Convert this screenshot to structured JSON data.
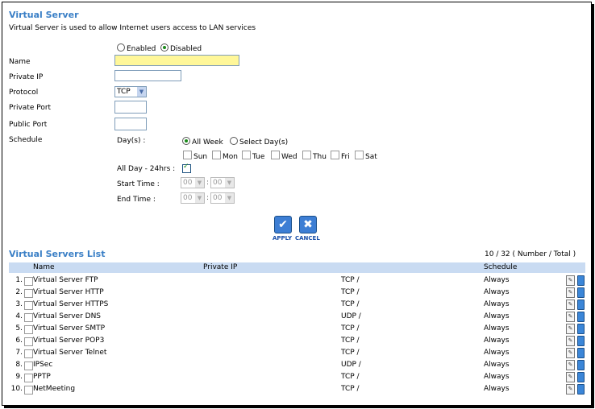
{
  "section": {
    "title": "Virtual Server",
    "description": "Virtual Server is used to allow Internet users access to LAN services",
    "enabled_label": "Enabled",
    "disabled_label": "Disabled",
    "selected_mode": "Disabled"
  },
  "form": {
    "name_label": "Name",
    "name_value": "",
    "private_ip_label": "Private IP",
    "private_ip_value": "",
    "protocol_label": "Protocol",
    "protocol_value": "TCP",
    "private_port_label": "Private Port",
    "private_port_value": "",
    "public_port_label": "Public Port",
    "public_port_value": "",
    "schedule_label": "Schedule",
    "days_label": "Day(s) :",
    "all_week_label": "All Week",
    "select_days_label": "Select Day(s)",
    "days": [
      "Sun",
      "Mon",
      "Tue",
      "Wed",
      "Thu",
      "Fri",
      "Sat"
    ],
    "all_day_label": "All Day - 24hrs :",
    "all_day_checked": true,
    "start_time_label": "Start Time :",
    "end_time_label": "End Time :",
    "time_hour": "00",
    "time_minute": "00",
    "time_separator": ":"
  },
  "buttons": {
    "apply_label": "APPLY",
    "cancel_label": "CANCEL"
  },
  "list": {
    "title": "Virtual Servers List",
    "count_text": "10 / 32 ( Number / Total )",
    "headers": {
      "name": "Name",
      "private_ip": "Private IP",
      "schedule": "Schedule"
    },
    "rows": [
      {
        "num": "1.",
        "name": "Virtual Server FTP",
        "protocol": "TCP /",
        "schedule": "Always"
      },
      {
        "num": "2.",
        "name": "Virtual Server HTTP",
        "protocol": "TCP /",
        "schedule": "Always"
      },
      {
        "num": "3.",
        "name": "Virtual Server HTTPS",
        "protocol": "TCP /",
        "schedule": "Always"
      },
      {
        "num": "4.",
        "name": "Virtual Server DNS",
        "protocol": "UDP /",
        "schedule": "Always"
      },
      {
        "num": "5.",
        "name": "Virtual Server SMTP",
        "protocol": "TCP /",
        "schedule": "Always"
      },
      {
        "num": "6.",
        "name": "Virtual Server POP3",
        "protocol": "TCP /",
        "schedule": "Always"
      },
      {
        "num": "7.",
        "name": "Virtual Server Telnet",
        "protocol": "TCP /",
        "schedule": "Always"
      },
      {
        "num": "8.",
        "name": "IPSec",
        "protocol": "UDP /",
        "schedule": "Always"
      },
      {
        "num": "9.",
        "name": "PPTP",
        "protocol": "TCP /",
        "schedule": "Always"
      },
      {
        "num": "10.",
        "name": "NetMeeting",
        "protocol": "TCP /",
        "schedule": "Always"
      }
    ]
  },
  "colors": {
    "title": "#3a7fc6",
    "header_bg": "#c9dbf2",
    "name_field_bg": "#fff799"
  }
}
